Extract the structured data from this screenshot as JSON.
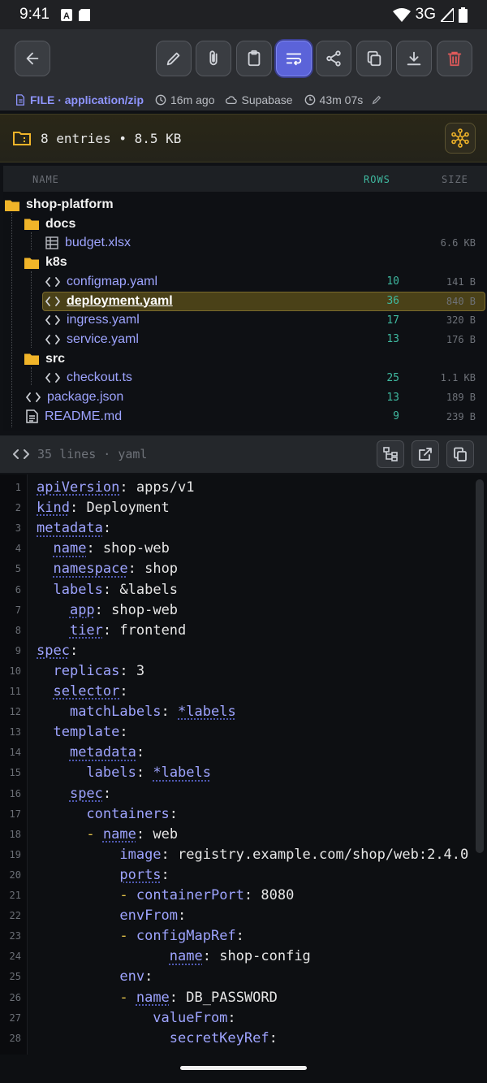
{
  "status": {
    "time": "9:41",
    "network": "3G"
  },
  "toolbar": {
    "buttons": [
      {
        "name": "back",
        "icon": "arrow-left-icon"
      },
      {
        "name": "edit",
        "icon": "pencil-icon"
      },
      {
        "name": "attach",
        "icon": "paperclip-icon"
      },
      {
        "name": "clipboard",
        "icon": "clipboard-icon"
      },
      {
        "name": "wrap",
        "icon": "wrap-lines-icon",
        "active": true
      },
      {
        "name": "share",
        "icon": "share-icon"
      },
      {
        "name": "copy",
        "icon": "copy-icon"
      },
      {
        "name": "download",
        "icon": "download-icon"
      },
      {
        "name": "delete",
        "icon": "trash-icon"
      }
    ]
  },
  "meta": {
    "file_type": "FILE · application/zip",
    "age": "16m ago",
    "source": "Supabase",
    "duration": "43m 07s"
  },
  "entries": {
    "summary": "8 entries • 8.5 KB"
  },
  "tree": {
    "headers": {
      "name": "NAME",
      "rows": "ROWS",
      "size": "SIZE"
    },
    "items": [
      {
        "label": "shop-platform",
        "kind": "folder",
        "depth": 0,
        "rows": "",
        "size": ""
      },
      {
        "label": "docs",
        "kind": "folder",
        "depth": 1,
        "rows": "",
        "size": ""
      },
      {
        "label": "budget.xlsx",
        "kind": "sheet",
        "depth": 2,
        "rows": "",
        "size": "6.6 KB"
      },
      {
        "label": "k8s",
        "kind": "folder",
        "depth": 1,
        "rows": "",
        "size": ""
      },
      {
        "label": "configmap.yaml",
        "kind": "code",
        "depth": 2,
        "rows": "10",
        "size": "141 B"
      },
      {
        "label": "deployment.yaml",
        "kind": "code",
        "depth": 2,
        "rows": "36",
        "size": "840 B",
        "selected": true
      },
      {
        "label": "ingress.yaml",
        "kind": "code",
        "depth": 2,
        "rows": "17",
        "size": "320 B"
      },
      {
        "label": "service.yaml",
        "kind": "code",
        "depth": 2,
        "rows": "13",
        "size": "176 B"
      },
      {
        "label": "src",
        "kind": "folder",
        "depth": 1,
        "rows": "",
        "size": ""
      },
      {
        "label": "checkout.ts",
        "kind": "code",
        "depth": 2,
        "rows": "25",
        "size": "1.1 KB"
      },
      {
        "label": "package.json",
        "kind": "code",
        "depth": 1,
        "rows": "13",
        "size": "189 B"
      },
      {
        "label": "README.md",
        "kind": "doc",
        "depth": 1,
        "rows": "9",
        "size": "239 B"
      }
    ]
  },
  "code": {
    "info": "35 lines · yaml",
    "lines": [
      {
        "n": "1",
        "indent": 0,
        "key": "apiVersion",
        "val": "apps/v1",
        "dotted": true
      },
      {
        "n": "2",
        "indent": 0,
        "key": "kind",
        "val": "Deployment",
        "dotted": true
      },
      {
        "n": "3",
        "indent": 0,
        "key": "metadata",
        "val": "",
        "dotted": true
      },
      {
        "n": "4",
        "indent": 1,
        "key": "name",
        "val": "shop-web",
        "dotted": true
      },
      {
        "n": "5",
        "indent": 1,
        "key": "namespace",
        "val": "shop",
        "dotted": true
      },
      {
        "n": "6",
        "indent": 1,
        "key": "labels",
        "val": "&labels",
        "dotted": false
      },
      {
        "n": "7",
        "indent": 2,
        "key": "app",
        "val": "shop-web",
        "dotted": true
      },
      {
        "n": "8",
        "indent": 2,
        "key": "tier",
        "val": "frontend",
        "dotted": true
      },
      {
        "n": "9",
        "indent": 0,
        "key": "spec",
        "val": "",
        "dotted": true
      },
      {
        "n": "10",
        "indent": 1,
        "key": "replicas",
        "val": "3",
        "dotted": false
      },
      {
        "n": "11",
        "indent": 1,
        "key": "selector",
        "val": "",
        "dotted": true
      },
      {
        "n": "12",
        "indent": 2,
        "key": "matchLabels",
        "val": "",
        "ref": "*labels",
        "dotted": false
      },
      {
        "n": "13",
        "indent": 1,
        "key": "template",
        "val": "",
        "dotted": false
      },
      {
        "n": "14",
        "indent": 2,
        "key": "metadata",
        "val": "",
        "dotted": true
      },
      {
        "n": "15",
        "indent": 3,
        "key": "labels",
        "val": "",
        "ref": "*labels",
        "dotted": false
      },
      {
        "n": "16",
        "indent": 2,
        "key": "spec",
        "val": "",
        "dotted": true
      },
      {
        "n": "17",
        "indent": 3,
        "key": "containers",
        "val": "",
        "dotted": false
      },
      {
        "n": "18",
        "indent": 4,
        "dash": true,
        "key": "name",
        "val": "web",
        "dotted": true
      },
      {
        "n": "19",
        "indent": 5,
        "key": "image",
        "val": "registry.example.com/shop/web:2.4.0",
        "dotted": false
      },
      {
        "n": "20",
        "indent": 5,
        "key": "ports",
        "val": "",
        "dotted": true
      },
      {
        "n": "21",
        "indent": 6,
        "dash": true,
        "key": "containerPort",
        "val": "8080",
        "dotted": false
      },
      {
        "n": "22",
        "indent": 5,
        "key": "envFrom",
        "val": "",
        "dotted": false
      },
      {
        "n": "23",
        "indent": 6,
        "dash": true,
        "key": "configMapRef",
        "val": "",
        "dotted": false
      },
      {
        "n": "24",
        "indent": 8,
        "key": "name",
        "val": "shop-config",
        "dotted": true
      },
      {
        "n": "25",
        "indent": 5,
        "key": "env",
        "val": "",
        "dotted": false
      },
      {
        "n": "26",
        "indent": 6,
        "dash": true,
        "key": "name",
        "val": "DB_PASSWORD",
        "dotted": true
      },
      {
        "n": "27",
        "indent": 7,
        "key": "valueFrom",
        "val": "",
        "dotted": false
      },
      {
        "n": "28",
        "indent": 8,
        "key": "secretKeyRef",
        "val": "",
        "dotted": false
      }
    ]
  },
  "colors": {
    "accent": "#5b63d9",
    "folder": "#f0b429",
    "rows": "#3fb9a0",
    "danger": "#e05a5a"
  }
}
